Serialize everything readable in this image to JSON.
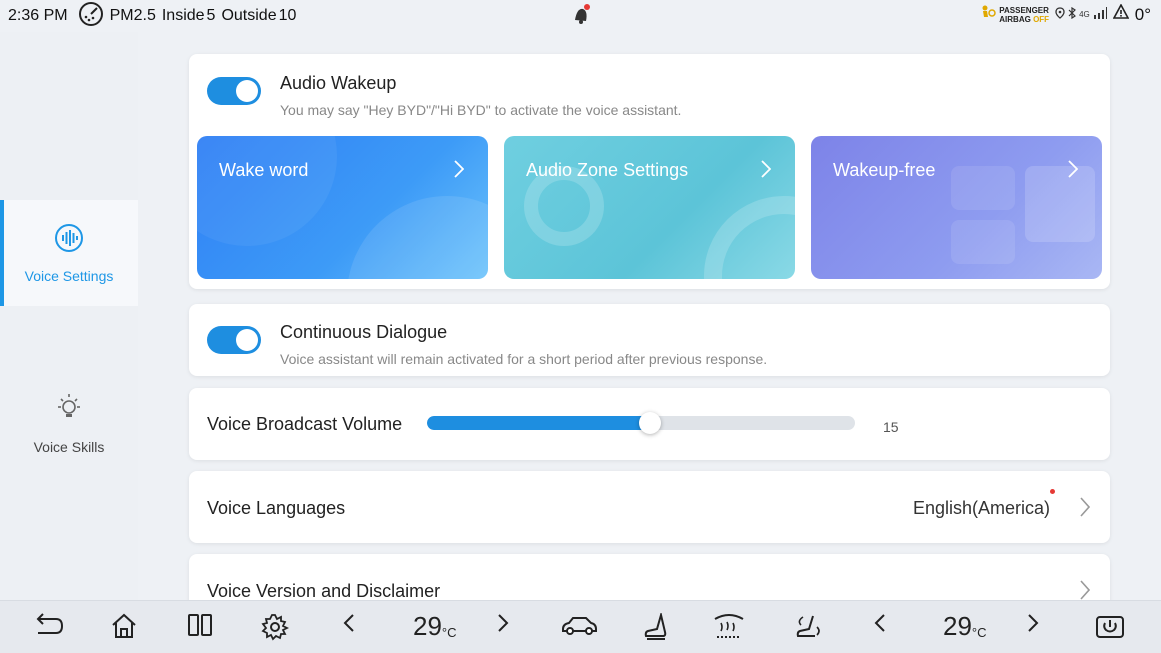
{
  "status_bar": {
    "time": "2:36 PM",
    "pm_label": "PM2.5",
    "inside_label": "Inside",
    "inside_value": "5",
    "outside_label": "Outside",
    "outside_value": "10",
    "airbag_line1": "PASSENGER",
    "airbag_line2": "AIRBAG",
    "airbag_state": "OFF",
    "network": "4G",
    "temperature": "0°"
  },
  "sidebar": {
    "items": [
      {
        "label": "Voice Settings",
        "icon": "voice-wave-icon",
        "active": true
      },
      {
        "label": "Voice Skills",
        "icon": "lightbulb-icon",
        "active": false
      }
    ]
  },
  "audio_wakeup": {
    "title": "Audio Wakeup",
    "subtitle": "You may say \"Hey BYD\"/\"Hi BYD\" to activate the voice assistant.",
    "enabled": true,
    "tiles": [
      {
        "label": "Wake word"
      },
      {
        "label": "Audio Zone Settings"
      },
      {
        "label": "Wakeup-free"
      }
    ]
  },
  "continuous_dialogue": {
    "title": "Continuous Dialogue",
    "subtitle": "Voice assistant will remain activated for a short period after previous response.",
    "enabled": true
  },
  "broadcast_volume": {
    "label": "Voice Broadcast Volume",
    "value": "15",
    "level_fraction": 0.52
  },
  "languages": {
    "label": "Voice Languages",
    "value": "English(America)"
  },
  "version": {
    "label": "Voice Version and Disclaimer"
  },
  "bottom_bar": {
    "left_temp": "29",
    "right_temp": "29",
    "temp_unit": "°C"
  },
  "colors": {
    "accent": "#1e8ee0",
    "active_text": "#1e97e6",
    "tile_blue": "#3d8ff5",
    "tile_teal": "#5cc4d8",
    "tile_purple": "#8e9cf0"
  }
}
